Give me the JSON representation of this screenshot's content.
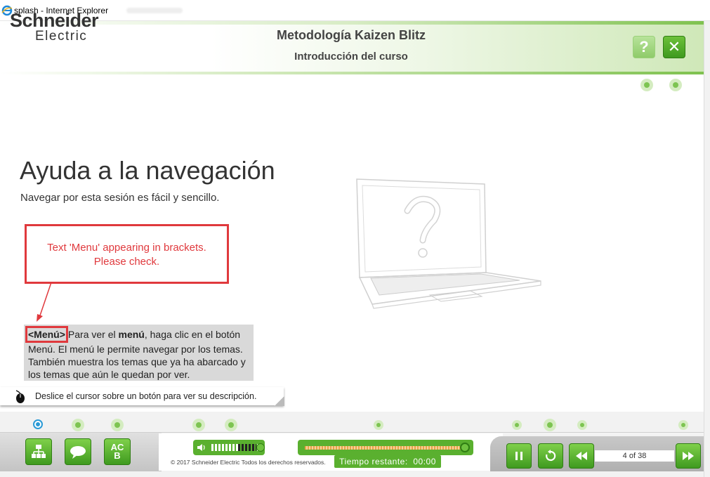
{
  "browser": {
    "title": "splash - Internet Explorer"
  },
  "header": {
    "logo_line1": "Schneider",
    "logo_line2": "Electric",
    "title": "Metodología Kaizen Blitz",
    "subtitle": "Introducción del curso",
    "help_label": "?",
    "close_label": "✕"
  },
  "content": {
    "title": "Ayuda a la navegación",
    "subtitle": "Navegar por esta sesión es fácil y sencillo."
  },
  "annotation": {
    "line1": "Text 'Menu' appearing in brackets.",
    "line2": "Please check."
  },
  "info": {
    "tag": "<Menú>",
    "text_a": "Para ver el ",
    "bold": "menú",
    "text_b": ", haga clic en el botón Menú. El menú le permite navegar por los temas. También muestra los temas que ya ha abarcado y los temas que aún le quedan por ver."
  },
  "hint": {
    "text": "Deslice el cursor sobre un botón para ver su descripción."
  },
  "footer": {
    "copyright": "© 2017 Schneider Electric Todos los derechos reservados.",
    "time_label": "Tiempo restante:",
    "time_value": "00:00",
    "page_indicator": "4 of 38",
    "menu_icon": "sitemap-icon",
    "chat_icon": "speech-bubble-icon",
    "glossary_label": "AC B"
  },
  "colors": {
    "accent": "#3f9a1f",
    "annotation": "#e0393d",
    "blue_dot": "#2a9ad6"
  }
}
